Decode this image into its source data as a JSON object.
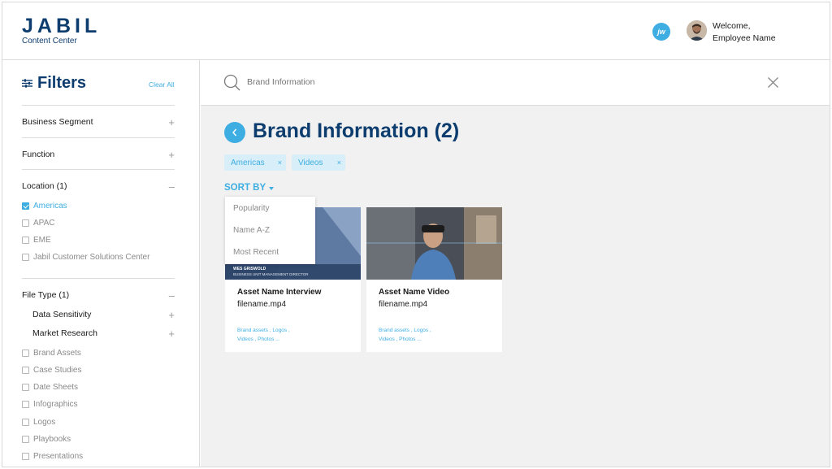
{
  "header": {
    "logo_text": "JABIL",
    "logo_sub": "Content Center",
    "badge_initials": "jw",
    "welcome_line1": "Welcome,",
    "welcome_line2": "Employee Name"
  },
  "sidebar": {
    "title": "Filters",
    "clear_all": "Clear All",
    "sections": {
      "business_segment": "Business Segment",
      "function": "Function",
      "location": "Location (1)",
      "file_type": "File Type (1)"
    },
    "location_options": [
      {
        "label": "Americas",
        "checked": true
      },
      {
        "label": "APAC",
        "checked": false
      },
      {
        "label": "EME",
        "checked": false
      },
      {
        "label": "Jabil Customer Solutions Center",
        "checked": false
      }
    ],
    "file_type_subsections": [
      "Data Sensitivity",
      "Market Research"
    ],
    "file_type_options": [
      {
        "label": "Brand Assets",
        "checked": false
      },
      {
        "label": "Case Studies",
        "checked": false
      },
      {
        "label": "Date Sheets",
        "checked": false
      },
      {
        "label": "Infographics",
        "checked": false
      },
      {
        "label": "Logos",
        "checked": false
      },
      {
        "label": "Playbooks",
        "checked": false
      },
      {
        "label": "Presentations",
        "checked": false
      }
    ],
    "signs": {
      "plus": "+",
      "minus": "–"
    }
  },
  "search": {
    "placeholder": "Brand Information",
    "value": ""
  },
  "main": {
    "title": "Brand Information (2)",
    "chips": [
      {
        "label": "Americas",
        "remove": "×"
      },
      {
        "label": "Videos",
        "remove": "×"
      }
    ],
    "sort_label": "SORT BY",
    "sort_options": [
      "Popularity",
      "Name A-Z",
      "Most Recent"
    ],
    "cards": [
      {
        "name": "Asset Name Interview",
        "file": "filename.mp4",
        "thumb_caption_1": "WES GRISWOLD",
        "thumb_caption_2": "BUSINESS UNIT MANAGEMENT DIRECTOR",
        "tags_line1": "Brand assets ,  Logos ,",
        "tags_line2": "Videos ,  Photos  ..."
      },
      {
        "name": "Asset Name Video",
        "file": "filename.mp4",
        "tags_line1": "Brand assets ,  Logos ,",
        "tags_line2": "Videos ,  Photos  ..."
      }
    ]
  },
  "colors": {
    "brand_navy": "#0d3d6e",
    "accent_blue": "#3eaee2",
    "chip_bg": "#d8eef9",
    "main_bg": "#f1f1f1"
  }
}
